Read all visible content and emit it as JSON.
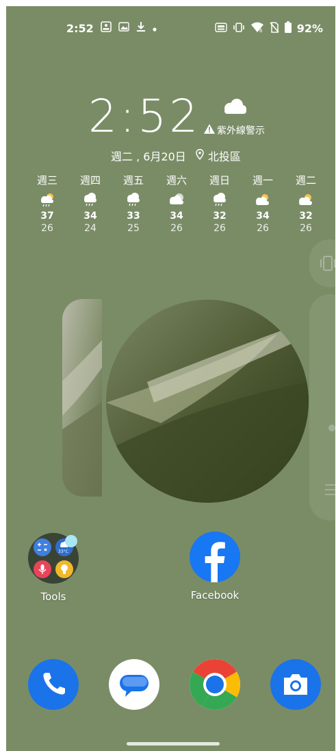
{
  "status_bar": {
    "time": "2:52",
    "left_icons": [
      "screen-record-icon",
      "gallery-icon",
      "download-icon",
      "dot-icon"
    ],
    "right_icons": [
      "auto-hd-icon",
      "vibrate-icon",
      "wifi-6-icon",
      "no-sim-icon",
      "battery-icon"
    ],
    "battery": "92%"
  },
  "clock": {
    "time": "2:52",
    "weather_icon": "cloud-icon",
    "warning": "紫外線警示",
    "date": "週二 , 6月20日",
    "location": "北投區"
  },
  "forecast": [
    {
      "day": "週三",
      "icon": "rain-sun-icon",
      "high": "37",
      "low": "26"
    },
    {
      "day": "週四",
      "icon": "rain-cloud-icon",
      "high": "34",
      "low": "24"
    },
    {
      "day": "週五",
      "icon": "rain-cloud-icon",
      "high": "33",
      "low": "25"
    },
    {
      "day": "週六",
      "icon": "cloudy-icon",
      "high": "34",
      "low": "26"
    },
    {
      "day": "週日",
      "icon": "rain-cloud-icon",
      "high": "32",
      "low": "26"
    },
    {
      "day": "週一",
      "icon": "partly-cloudy-icon",
      "high": "34",
      "low": "26"
    },
    {
      "day": "週二",
      "icon": "partly-cloudy-icon",
      "high": "32",
      "low": "26"
    }
  ],
  "apps": {
    "tools": {
      "label": "Tools",
      "mini_weather_temp": "33°C"
    },
    "facebook": {
      "label": "Facebook"
    }
  },
  "dock": [
    "phone-icon",
    "messages-icon",
    "chrome-icon",
    "camera-icon"
  ],
  "colors": {
    "wallpaper": "#7a8c66",
    "facebook_blue": "#1877f2",
    "phone_blue": "#1a73e8",
    "camera_blue": "#1a73e8"
  }
}
